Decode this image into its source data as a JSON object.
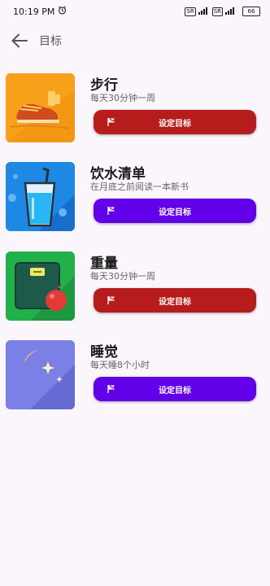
{
  "status_bar": {
    "time": "10:19 PM",
    "sim1_label": "SR",
    "sim2_label": "SR",
    "battery": "66"
  },
  "header": {
    "title": "目标"
  },
  "goals": [
    {
      "title": "步行",
      "subtitle": "每天30分钟一周",
      "button_label": "设定目标",
      "icon": "walking-shoe-icon",
      "thumb_color": "#f7a11a",
      "button_color": "#b71c1c"
    },
    {
      "title": "饮水清单",
      "subtitle": "在月底之前阅读一本新书",
      "button_label": "设定目标",
      "icon": "water-glass-icon",
      "thumb_color": "#1e88e5",
      "button_color": "#6200ea"
    },
    {
      "title": "重量",
      "subtitle": "每天30分钟一周",
      "button_label": "设定目标",
      "icon": "weight-scale-icon",
      "thumb_color": "#22b04b",
      "button_color": "#b71c1c"
    },
    {
      "title": "睡觉",
      "subtitle": "每天睡8个小时",
      "button_label": "设定目标",
      "icon": "moon-stars-icon",
      "thumb_color": "#7a80e6",
      "button_color": "#6200ea"
    }
  ]
}
